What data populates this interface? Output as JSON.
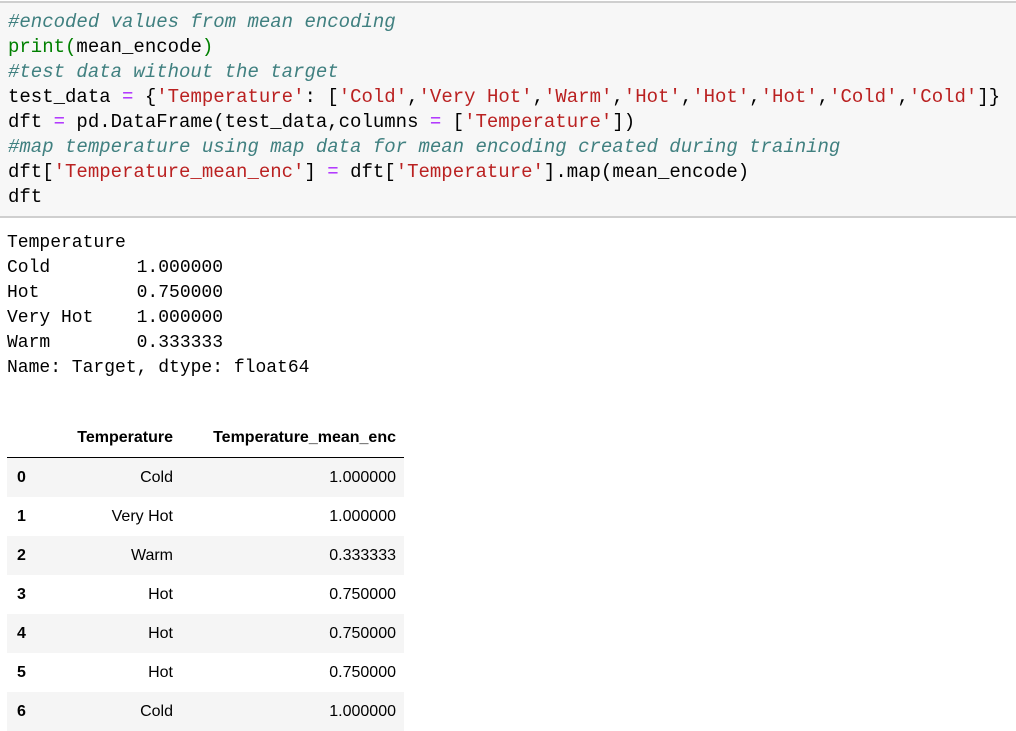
{
  "code_cell": {
    "lines": [
      [
        [
          "cm",
          "#encoded values from mean encoding"
        ]
      ],
      [
        [
          "bi",
          "print"
        ],
        [
          "bi",
          "("
        ],
        [
          "p",
          "mean_encode"
        ],
        [
          "bi",
          ")"
        ]
      ],
      [
        [
          "cm",
          "#test data without the target"
        ]
      ],
      [
        [
          "p",
          "test_data "
        ],
        [
          "op",
          "="
        ],
        [
          "p",
          " {"
        ],
        [
          "s",
          "'Temperature'"
        ],
        [
          "p",
          ": ["
        ],
        [
          "s",
          "'Cold'"
        ],
        [
          "p",
          ","
        ],
        [
          "s",
          "'Very Hot'"
        ],
        [
          "p",
          ","
        ],
        [
          "s",
          "'Warm'"
        ],
        [
          "p",
          ","
        ],
        [
          "s",
          "'Hot'"
        ],
        [
          "p",
          ","
        ],
        [
          "s",
          "'Hot'"
        ],
        [
          "p",
          ","
        ],
        [
          "s",
          "'Hot'"
        ],
        [
          "p",
          ","
        ],
        [
          "s",
          "'Cold'"
        ],
        [
          "p",
          ","
        ],
        [
          "s",
          "'Cold'"
        ],
        [
          "p",
          "]}"
        ]
      ],
      [
        [
          "p",
          "dft "
        ],
        [
          "op",
          "="
        ],
        [
          "p",
          " pd.DataFrame(test_data,columns "
        ],
        [
          "op",
          "="
        ],
        [
          "p",
          " ["
        ],
        [
          "s",
          "'Temperature'"
        ],
        [
          "p",
          "])"
        ]
      ],
      [
        [
          "cm",
          "#map temperature using map data for mean encoding created during training"
        ]
      ],
      [
        [
          "p",
          "dft["
        ],
        [
          "s",
          "'Temperature_mean_enc'"
        ],
        [
          "p",
          "] "
        ],
        [
          "op",
          "="
        ],
        [
          "p",
          " dft["
        ],
        [
          "s",
          "'Temperature'"
        ],
        [
          "p",
          "].map(mean_encode)"
        ]
      ],
      [
        [
          "p",
          "dft"
        ]
      ]
    ]
  },
  "stdout": {
    "lines": [
      "Temperature",
      "Cold        1.000000",
      "Hot         0.750000",
      "Very Hot    1.000000",
      "Warm        0.333333",
      "Name: Target, dtype: float64"
    ]
  },
  "dataframe": {
    "columns": [
      "",
      "Temperature",
      "Temperature_mean_enc"
    ],
    "rows": [
      [
        "0",
        "Cold",
        "1.000000"
      ],
      [
        "1",
        "Very Hot",
        "1.000000"
      ],
      [
        "2",
        "Warm",
        "0.333333"
      ],
      [
        "3",
        "Hot",
        "0.750000"
      ],
      [
        "4",
        "Hot",
        "0.750000"
      ],
      [
        "5",
        "Hot",
        "0.750000"
      ],
      [
        "6",
        "Cold",
        "1.000000"
      ]
    ]
  }
}
